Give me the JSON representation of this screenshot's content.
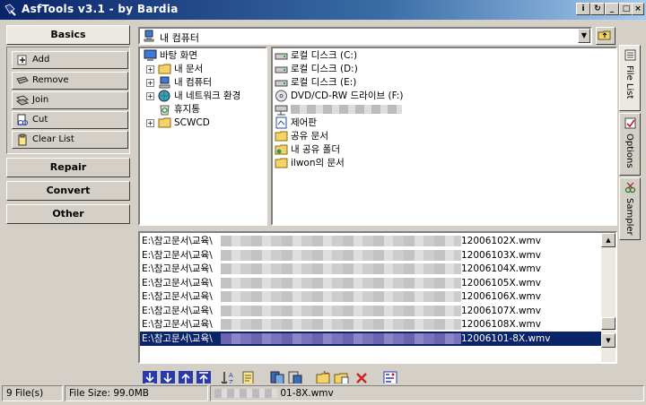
{
  "window": {
    "title": "AsfTools v3.1 - by Bardia"
  },
  "left_panel": {
    "basics_label": "Basics",
    "buttons": [
      {
        "label": "Add",
        "icon": "add-icon"
      },
      {
        "label": "Remove",
        "icon": "remove-icon"
      },
      {
        "label": "Join",
        "icon": "join-icon"
      },
      {
        "label": "Cut",
        "icon": "cut-icon"
      },
      {
        "label": "Clear List",
        "icon": "clear-list-icon"
      }
    ],
    "repair_label": "Repair",
    "convert_label": "Convert",
    "other_label": "Other"
  },
  "location": {
    "value": "내 컴퓨터",
    "icon": "my-computer-icon"
  },
  "tree": [
    {
      "label": "바탕 화면",
      "icon": "desktop-icon",
      "expander": ""
    },
    {
      "label": "내 문서",
      "icon": "folder-icon",
      "expander": "+"
    },
    {
      "label": "내 컴퓨터",
      "icon": "computer-icon",
      "expander": "+"
    },
    {
      "label": "내 네트워크 환경",
      "icon": "network-icon",
      "expander": "+"
    },
    {
      "label": "휴지통",
      "icon": "recycle-bin-icon",
      "expander": ""
    },
    {
      "label": "SCWCD",
      "icon": "folder-icon",
      "expander": "+"
    }
  ],
  "folder_list": [
    {
      "label": "로컬 디스크 (C:)",
      "icon": "drive-icon"
    },
    {
      "label": "로컬 디스크 (D:)",
      "icon": "drive-icon"
    },
    {
      "label": "로컬 디스크 (E:)",
      "icon": "drive-icon"
    },
    {
      "label": "DVD/CD-RW 드라이브 (F:)",
      "icon": "dvd-drive-icon"
    },
    {
      "label": "",
      "icon": "network-drive-icon"
    },
    {
      "label": "제어판",
      "icon": "control-panel-icon"
    },
    {
      "label": "공유 문서",
      "icon": "folder-icon"
    },
    {
      "label": "내 공유 폴더",
      "icon": "shared-folder-icon"
    },
    {
      "label": "ilwon의 문서",
      "icon": "folder-icon"
    }
  ],
  "side_tabs": [
    {
      "label": "File List",
      "icon": "file-list-icon"
    },
    {
      "label": "Options",
      "icon": "options-icon"
    },
    {
      "label": "Sampler",
      "icon": "sampler-icon"
    }
  ],
  "files": [
    {
      "prefix": "E:\\참고문서\\교육\\",
      "suffix": "12006102X.wmv",
      "selected": false
    },
    {
      "prefix": "E:\\참고문서\\교육\\",
      "suffix": "12006103X.wmv",
      "selected": false
    },
    {
      "prefix": "E:\\참고문서\\교육\\",
      "suffix": "12006104X.wmv",
      "selected": false
    },
    {
      "prefix": "E:\\참고문서\\교육\\",
      "suffix": "12006105X.wmv",
      "selected": false
    },
    {
      "prefix": "E:\\참고문서\\교육\\",
      "suffix": "12006106X.wmv",
      "selected": false
    },
    {
      "prefix": "E:\\참고문서\\교육\\",
      "suffix": "12006107X.wmv",
      "selected": false
    },
    {
      "prefix": "E:\\참고문서\\교육\\",
      "suffix": "12006108X.wmv",
      "selected": false
    },
    {
      "prefix": "E:\\참고문서\\교육\\",
      "suffix": "12006101-8X.wmv",
      "selected": true
    }
  ],
  "toolbar_icons": [
    "move-bottom-icon",
    "move-down-icon",
    "move-up-icon",
    "move-top-icon",
    "sort-icon",
    "properties-icon",
    "copy-icon",
    "paste-icon",
    "open-folder-icon",
    "open-folder-2-icon",
    "delete-icon",
    "settings-icon"
  ],
  "status": {
    "file_count": "9 File(s)",
    "file_size": "File Size: 99.0MB",
    "current_file": "01-8X.wmv"
  },
  "colors": {
    "title_start": "#0a246a",
    "title_end": "#a6caf0",
    "selection": "#0a246a",
    "face": "#d4d0c8"
  }
}
